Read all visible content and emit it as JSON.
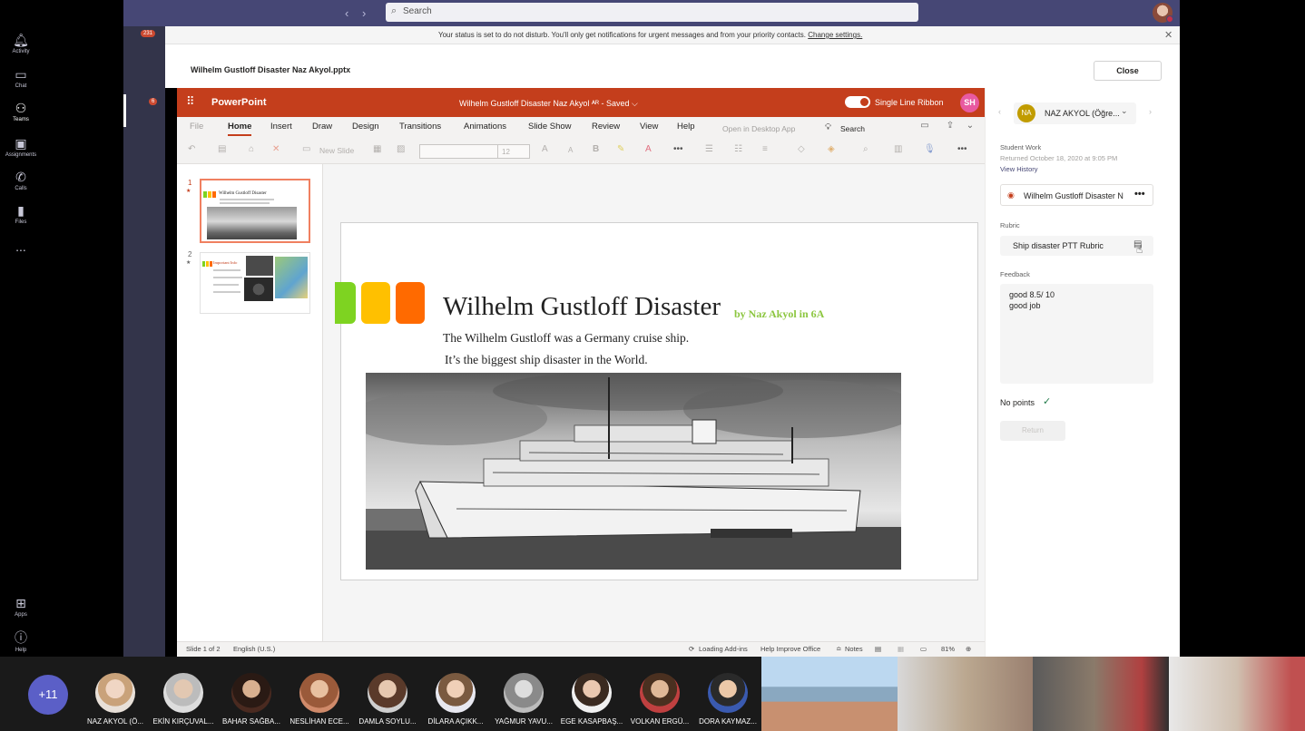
{
  "teams": {
    "search_placeholder": "Search",
    "nav_back": "‹",
    "nav_forward": "›",
    "rail": [
      {
        "label": "Activity",
        "icon": "bell-icon",
        "badge": "231"
      },
      {
        "label": "Chat",
        "icon": "chat-icon"
      },
      {
        "label": "Teams",
        "icon": "teams-icon",
        "badge": "6"
      },
      {
        "label": "Assignments",
        "icon": "assignments-icon"
      },
      {
        "label": "Calls",
        "icon": "phone-icon"
      },
      {
        "label": "Files",
        "icon": "file-icon"
      },
      {
        "label": "...",
        "icon": "more-icon"
      },
      {
        "label": "Apps",
        "icon": "apps-icon"
      },
      {
        "label": "Help",
        "icon": "help-icon"
      }
    ],
    "dnd_message": "Your status is set to do not disturb. You'll only get notifications for urgent messages and from your priority contacts.",
    "dnd_link": "Change settings.",
    "dnd_close": "✕"
  },
  "doc": {
    "title": "Wilhelm Gustloff Disaster Naz Akyol.pptx",
    "close_label": "Close"
  },
  "ppt": {
    "brand": "PowerPoint",
    "file_status": "Wilhelm Gustloff Disaster Naz Akyol  ᴬᴿ  -  Saved ⌵",
    "ribbon_toggle_label": "Single Line Ribbon",
    "user_initials": "SH",
    "tabs": [
      "File",
      "Home",
      "Insert",
      "Draw",
      "Design",
      "Transitions",
      "Animations",
      "Slide Show",
      "Review",
      "View",
      "Help"
    ],
    "open_desktop": "Open in Desktop App",
    "search_label": "Search",
    "new_slide": "New Slide",
    "font_size": "12",
    "slide": {
      "title": "Wilhelm Gustloff Disaster",
      "byline": "by Naz Akyol in 6A",
      "line1": "The Wilhelm Gustloff  was  a Germany cruise ship.",
      "line2": "It’s the biggest ship disaster in the World."
    },
    "thumbs": [
      {
        "number": "1",
        "title": "Wilhelm Gustloff Disaster"
      },
      {
        "number": "2",
        "title": "Important Info"
      }
    ],
    "status": {
      "slide_count": "Slide 1 of 2",
      "language": "English (U.S.)",
      "addins": "Loading Add-ins",
      "improve": "Help Improve Office",
      "notes": "Notes",
      "zoom": "81%"
    },
    "colors": {
      "accent": "#c43e1c",
      "sq1": "#7ed321",
      "sq2": "#ffc000",
      "sq3": "#ff6a00"
    }
  },
  "panel": {
    "student_initials": "NA",
    "student_name": "NAZ AKYOL (Öğre...",
    "section_label": "Student Work",
    "returned": "Returned October 18, 2020 at 9:05 PM",
    "view_history": "View History",
    "file_name": "Wilhelm Gustloff Disaster N",
    "rubric_label": "Rubric",
    "rubric_name": "Ship disaster PTT Rubric",
    "feedback_label": "Feedback",
    "feedback_text": "good 8.5/ 10\ngood job",
    "points": "No points",
    "return_label": "Return"
  },
  "meeting": {
    "more_count": "+11",
    "participants": [
      "NAZ AKYOL (Ö...",
      "EKİN KIRÇUVAL...",
      "BAHAR SAĞBA...",
      "NESLİHAN ECE...",
      "DAMLA SOYLU...",
      "DİLARA AÇIKK...",
      "YAĞMUR YAVU...",
      "EGE KASAPBAŞ...",
      "VOLKAN ERGÜ...",
      "DORA KAYMAZ..."
    ]
  }
}
